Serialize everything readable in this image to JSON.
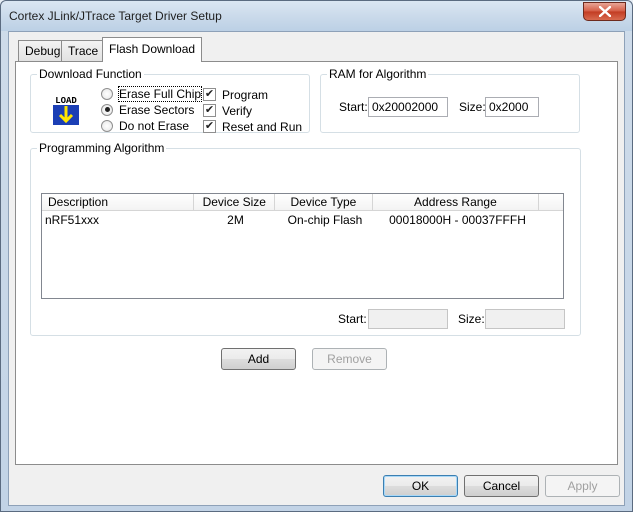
{
  "window": {
    "title": "Cortex JLink/JTrace Target Driver Setup"
  },
  "tabs": [
    {
      "label": "Debug"
    },
    {
      "label": "Trace"
    },
    {
      "label": "Flash Download"
    }
  ],
  "download_function": {
    "title": "Download Function",
    "icon": "load-icon",
    "icon_text": "LOAD",
    "erase_options": [
      {
        "label": "Erase Full Chip",
        "selected": false
      },
      {
        "label": "Erase Sectors",
        "selected": true
      },
      {
        "label": "Do not Erase",
        "selected": false
      }
    ],
    "checks": [
      {
        "label": "Program",
        "checked": true
      },
      {
        "label": "Verify",
        "checked": true
      },
      {
        "label": "Reset and Run",
        "checked": true
      }
    ]
  },
  "ram_for_algorithm": {
    "title": "RAM for Algorithm",
    "start_label": "Start:",
    "start_value": "0x20002000",
    "size_label": "Size:",
    "size_value": "0x2000"
  },
  "programming_algorithm": {
    "title": "Programming Algorithm",
    "columns": [
      "Description",
      "Device Size",
      "Device Type",
      "Address Range"
    ],
    "rows": [
      {
        "description": "nRF51xxx",
        "device_size": "2M",
        "device_type": "On-chip Flash",
        "address_range": "00018000H - 00037FFFH"
      }
    ],
    "start_label": "Start:",
    "start_value": "",
    "size_label": "Size:",
    "size_value": ""
  },
  "buttons": {
    "add": "Add",
    "remove": "Remove",
    "ok": "OK",
    "cancel": "Cancel",
    "apply": "Apply"
  }
}
